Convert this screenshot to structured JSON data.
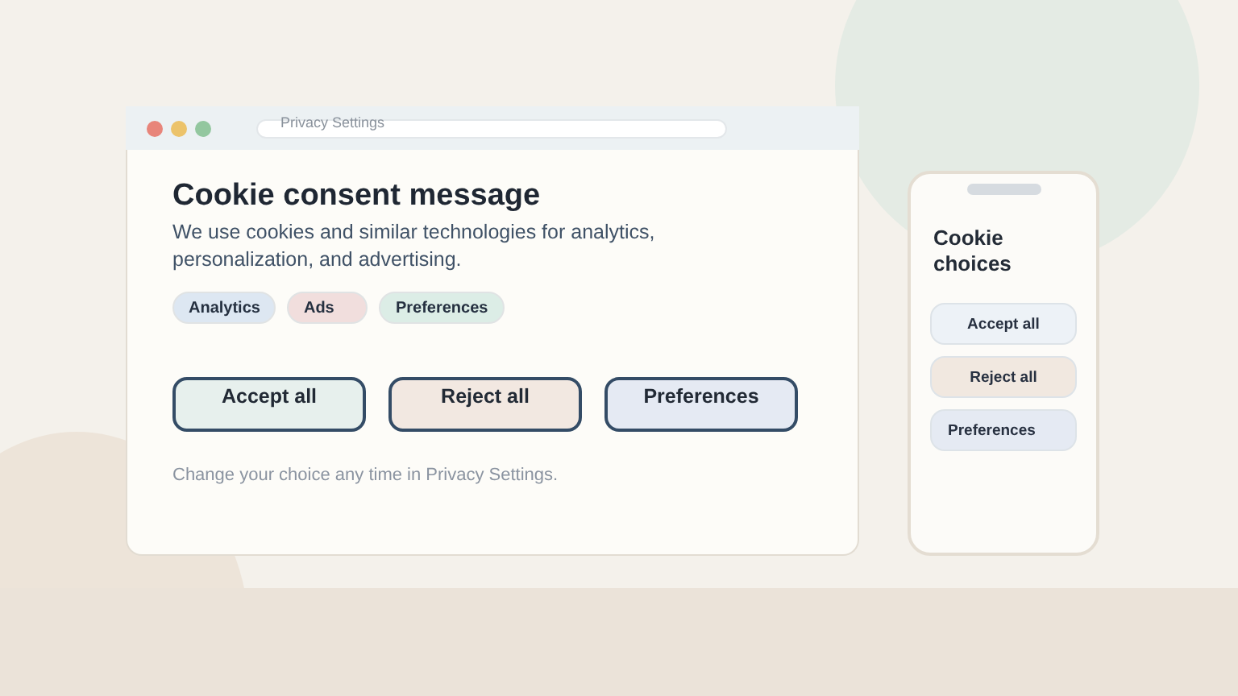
{
  "browser": {
    "address": "Privacy Settings",
    "title": "Cookie consent message",
    "message": "We use cookies and similar technologies for analytics, personalization, and advertising.",
    "tags": [
      {
        "label": "Analytics",
        "color": "#dde7f2"
      },
      {
        "label": "Ads",
        "color": "#f1dedd"
      },
      {
        "label": "Preferences",
        "color": "#dcede6"
      }
    ],
    "buttons": [
      {
        "label": "Accept all",
        "color": "#e7f0ed"
      },
      {
        "label": "Reject all",
        "color": "#f2e8e1"
      },
      {
        "label": "Preferences",
        "color": "#e5eaf3"
      }
    ],
    "footnote": "Change your choice any time in Privacy Settings."
  },
  "phone": {
    "title": "Cookie choices",
    "buttons": [
      {
        "label": "Accept all",
        "color": "#edf2f7"
      },
      {
        "label": "Reject all",
        "color": "#f1e8e0"
      },
      {
        "label": "Preferences",
        "color": "#e5eaf3"
      }
    ]
  }
}
